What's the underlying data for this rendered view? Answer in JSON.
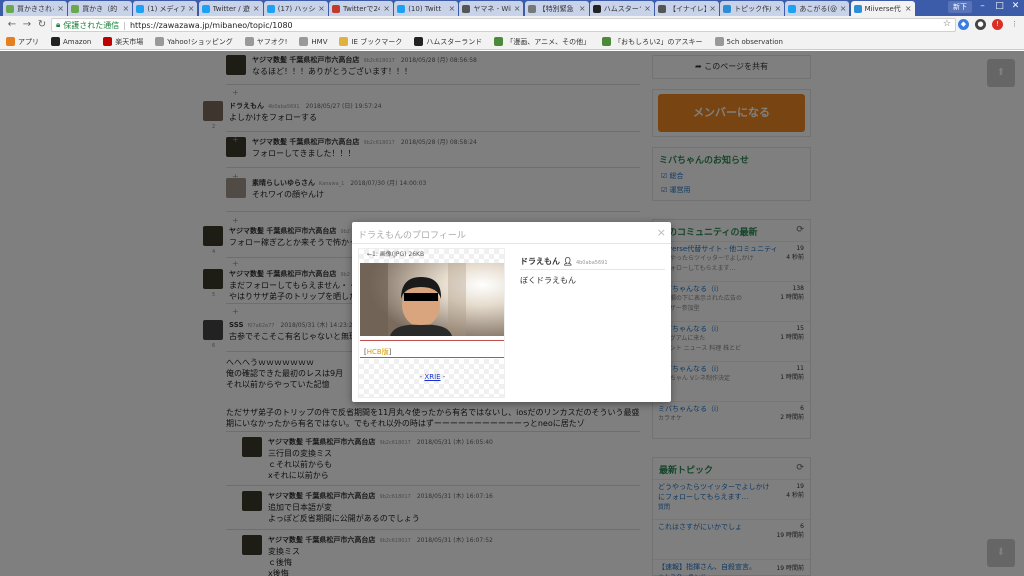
{
  "tabs": [
    {
      "label": "買かきされる",
      "icon": "doc-icon",
      "color": "#6aa84f"
    },
    {
      "label": "買かき（的",
      "icon": "doc-icon",
      "color": "#6aa84f"
    },
    {
      "label": "(1) メディア",
      "icon": "twitter-icon",
      "color": "#1da1f2"
    },
    {
      "label": "Twitter / 遊",
      "icon": "twitter-icon",
      "color": "#1da1f2"
    },
    {
      "label": "(17) ハッシ",
      "icon": "twitter-icon",
      "color": "#1da1f2"
    },
    {
      "label": "Twitterで24",
      "icon": "doc-icon",
      "color": "#c0392b"
    },
    {
      "label": "(10) Twitt",
      "icon": "twitter-icon",
      "color": "#1da1f2"
    },
    {
      "label": "ヤマネ - Wiki",
      "icon": "wikipedia-icon",
      "color": "#555555"
    },
    {
      "label": "【特別緊急",
      "icon": "doc-icon",
      "color": "#777777"
    },
    {
      "label": "ハムスターラ",
      "icon": "doc-icon",
      "color": "#222222"
    },
    {
      "label": "【イナイレ】",
      "icon": "doc-icon",
      "color": "#555555"
    },
    {
      "label": "トピック作成",
      "icon": "doc-icon",
      "color": "#2c8fd6"
    },
    {
      "label": "あこがる(@",
      "icon": "twitter-icon",
      "color": "#1da1f2"
    },
    {
      "label": "Miiverse代",
      "icon": "doc-icon",
      "color": "#2c8fd6"
    }
  ],
  "user_chip": "新下",
  "address": {
    "secure_label": "保護された通信",
    "url": "https://zawazawa.jp/mibaneo/topic/1080"
  },
  "bookmarks": [
    {
      "label": "アプリ",
      "icon": "apps-grid-icon",
      "color": "#e67e22"
    },
    {
      "label": "Amazon",
      "icon": "amazon-icon",
      "color": "#222222"
    },
    {
      "label": "楽天市場",
      "icon": "rakuten-icon",
      "color": "#bf0000"
    },
    {
      "label": "Yahoo!ショッピング",
      "icon": "page-icon",
      "color": "#999999"
    },
    {
      "label": "ヤフオク!",
      "icon": "page-icon",
      "color": "#999999"
    },
    {
      "label": "HMV",
      "icon": "page-icon",
      "color": "#999999"
    },
    {
      "label": "IE ブックマーク",
      "icon": "folder-icon",
      "color": "#e0b040"
    },
    {
      "label": "ハムスターランド",
      "icon": "x-icon",
      "color": "#222222"
    },
    {
      "label": "「漫画、アニメ、その他」",
      "icon": "check-icon",
      "color": "#4a8a3a"
    },
    {
      "label": "「おもしろい2」のアスキー",
      "icon": "check-icon",
      "color": "#4a8a3a"
    },
    {
      "label": "5ch observation",
      "icon": "page-icon",
      "color": "#999999"
    }
  ],
  "posts": [
    {
      "name": "ヤジマ数髪 千葉県松戸市六高台店",
      "uid": "9b2c618017",
      "date": "2018/05/28 (月) 08:56:58",
      "body": "なるほど！！！ありがとうございます！！！",
      "num": ""
    },
    {
      "name": "ドラえもん",
      "uid": "4b0aba5691",
      "date": "2018/05/27 (日) 19:57:24",
      "body": "よしかけをフォローする",
      "num": "2"
    },
    {
      "name": "ヤジマ数髪 千葉県松戸市六高台店",
      "uid": "9b2c618017",
      "date": "2018/05/28 (月) 08:58:24",
      "body": "フォローしてきました！！！",
      "num": ""
    },
    {
      "name": "素晴らしいゆらさん",
      "uid": "Kanawa_1",
      "date": "2018/07/30 (月) 14:00:03",
      "body": "それワイの顔やんけ",
      "num": ""
    },
    {
      "name": "ヤジマ数髪 千葉県松戸市六高台店",
      "uid": "9b2",
      "date": "",
      "body": "フォロー稼ぎ乙とか来そうで怖かっ",
      "num": "4"
    },
    {
      "name": "ヤジマ数髪 千葉県松戸市六高台店",
      "uid": "9b2",
      "date": "",
      "body": "まだフォローしてもらえません・・\nやはりサザ弟子のトリップを晒した",
      "num": "5"
    },
    {
      "name": "SSS",
      "uid": "f07a62e77",
      "date": "2018/05/31 (木) 14:23:2",
      "body": "古参でそこそこ有名じゃないと無理",
      "num": "6"
    },
    {
      "name": "",
      "uid": "",
      "date": "",
      "body": "へへへうｗｗｗｗｗｗｗ\n俺の確認できた最初のレスは9月\nそれ以前からやっていた記憶",
      "num": ""
    },
    {
      "name": "",
      "uid": "",
      "date": "",
      "body": "ただサザ弟子のトリップの件で反省期間を11月丸々使ったから有名ではないし、iosだのリンカスだのそういう最盛\n期にいなかったから有名ではない。でもそれ以外の時はずーーーーーーーーーーーっとneoに居たゾ",
      "num": ""
    },
    {
      "name": "ヤジマ数髪 千葉県松戸市六高台店",
      "uid": "9b2c618017",
      "date": "2018/05/31 (木) 16:05:40",
      "body": "三行目の変換ミス\nｃそれ以前からも\nxそれに以前から",
      "num": ""
    },
    {
      "name": "ヤジマ数髪 千葉県松戸市六高台店",
      "uid": "9b2c618017",
      "date": "2018/05/31 (木) 16:07:16",
      "body": "追加で日本語が変\nよっぽど反省期間に公開があるのでしょう",
      "num": ""
    },
    {
      "name": "ヤジマ数髪 千葉県松戸市六高台店",
      "uid": "9b2c618017",
      "date": "2018/05/31 (木) 16:07:52",
      "body": "変換ミス\nｃ後悔\nx後悔",
      "num": ""
    }
  ],
  "sidebar": {
    "share_label": "このページを共有",
    "member_button": "メンバーになる",
    "news_title": "ミバちゃんのお知らせ",
    "news_links": [
      "総合",
      "運営用"
    ],
    "community_title": "このコミュニティの最新",
    "community_items": [
      {
        "text": "Miiverse代替サイト - 他コミュニティ",
        "sub": "どうやったらツイッターでよしかけ\nにフォローしてもらえます…",
        "count": "19",
        "time": "4 秒前"
      },
      {
        "text": "ミバちゃんなる（i）",
        "sub": "投稿欄の下に表示された広告の\n...ーザー参加型",
        "count": "138",
        "time": "1 時間前"
      },
      {
        "text": "ミバちゃんなる（i）",
        "sub": "...でグアムに来た\n...ベント ニュース 料理 株とビ",
        "count": "15",
        "time": "1 時間前"
      },
      {
        "text": "ミバちゃんなる（i）",
        "sub": "ミバちゃん Vシネ制作決定",
        "count": "11",
        "time": "1 時間前"
      },
      {
        "text": "ミバちゃんなる（i）",
        "sub": "カラオケ",
        "count": "6",
        "time": "2 時間前"
      }
    ],
    "topics_title": "最新トピック",
    "topics": [
      {
        "text": "どうやったらツイッターでよしかけ\nにフォローしてもらえます…",
        "tag": "質問",
        "count": "19",
        "time": "4 秒前"
      },
      {
        "text": "これはさすがにいかでしょ",
        "tag": "",
        "count": "6",
        "time": "19 時間前"
      },
      {
        "text": "【速報】指揮さん、自殺宣言。",
        "tag": "ハムスターランド",
        "count": "",
        "time": "19 時間前"
      }
    ]
  },
  "modal": {
    "title": "ドラえもんのプロフィール",
    "close": "×",
    "image_caption": "←1: 画像(JPG) 26KB",
    "link1_prefix": "[",
    "link1": "HCB版",
    "link1_suffix": "]",
    "link2_prefix": "- ",
    "link2": "XRIE",
    "link2_suffix": " -",
    "name": "ドラえもん",
    "uid": "4b0aba5691",
    "bio": "ぼくドラえもん"
  }
}
